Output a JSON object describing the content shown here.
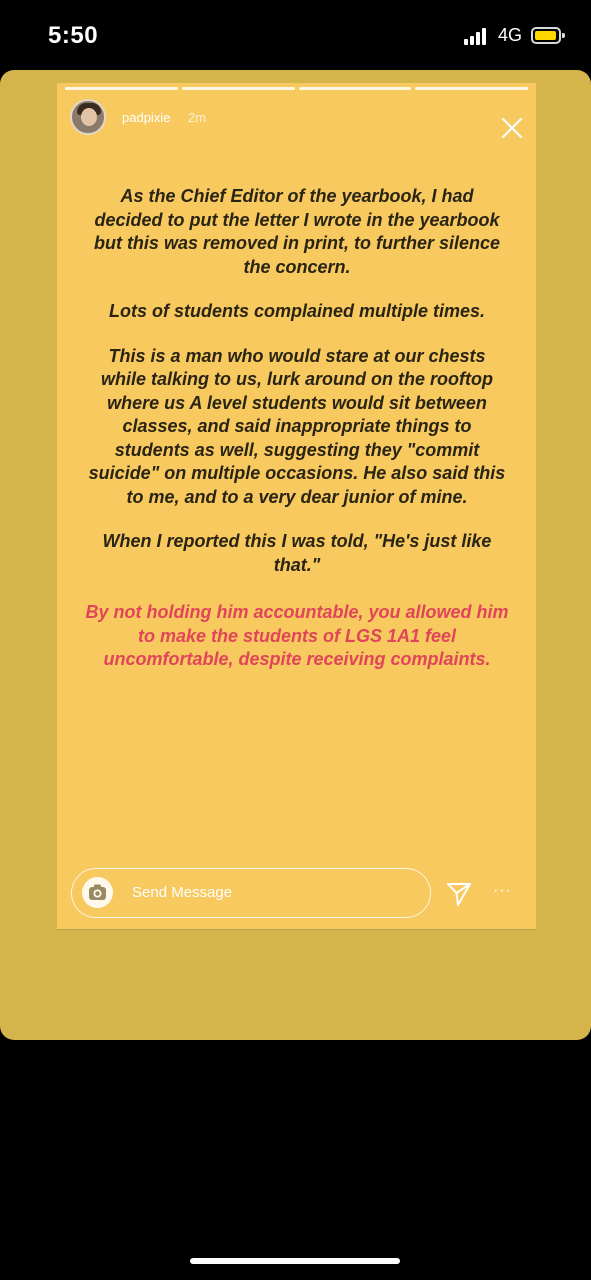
{
  "status_bar": {
    "time": "5:50",
    "network": "4G"
  },
  "story": {
    "username": "padpixie",
    "time_ago": "2m",
    "segments": 4,
    "paragraphs": [
      "As the Chief Editor of the yearbook, I had decided to put the letter I wrote in the yearbook but this was removed in print, to further silence the concern.",
      "Lots of students complained multiple times.",
      "This is a man who would stare at our chests while talking to us, lurk around on the rooftop where us A level students would sit between classes, and said inappropriate things to students as well, suggesting they \"commit suicide\" on multiple occasions. He also said this to me, and to a very dear junior of mine.",
      "When I reported this I was told, \"He's just like that.\""
    ],
    "highlight": "By not holding him accountable, you allowed him to make the students of LGS 1A1 feel uncomfortable, despite receiving complaints.",
    "colors": {
      "background": "#f7c95e",
      "text": "#2a2415",
      "highlight": "#e0455a"
    }
  },
  "message_bar": {
    "placeholder": "Send Message",
    "more_label": "···"
  }
}
